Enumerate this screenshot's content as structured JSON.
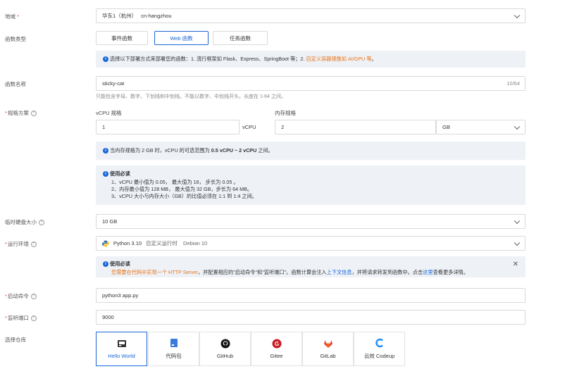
{
  "region": {
    "label": "地域",
    "value_name": "华东1（杭州）",
    "value_code": "cn-hangzhou"
  },
  "function_type": {
    "label": "函数类型",
    "options": [
      "事件函数",
      "Web 函数",
      "任务函数"
    ],
    "selected": "Web 函数"
  },
  "deploy_info": {
    "text": "选择以下部署方式来部署您的函数：1. 流行框架如 Flask、Express、SpringBoot 等；2. ",
    "link": "自定义容器镜像如 AI/GPU 等",
    "suffix": "。"
  },
  "function_name": {
    "label": "函数名称",
    "value": "sticky-cat",
    "counter": "10/64",
    "hint": "只能包含字母、数字、下划线和中划线。不能以数字、中划线开头。长度在 1-64 之间。"
  },
  "spec": {
    "label": "规格方案",
    "vcpu_label": "vCPU 规格",
    "vcpu_value": "1",
    "vcpu_unit": "vCPU",
    "mem_label": "内存规格",
    "mem_value": "2",
    "mem_unit": "GB",
    "range_prefix": "当内存规格为 2 GB 时，vCPU 的可选范围为 ",
    "range_value": "0.5 vCPU ~ 2 vCPU",
    "range_suffix": " 之间。",
    "notice_title": "使用必读",
    "notice_items": [
      "1、vCPU 最小值为 0.05， 最大值为 16， 步长为 0.05 。",
      "2、内存最小值为 128 MB， 最大值为 32 GB，步长为 64 MB。",
      "3、vCPU 大小与内存大小（GB）的比值必须在 1:1 到 1:4 之间。"
    ]
  },
  "disk": {
    "label": "临时硬盘大小",
    "value": "10 GB"
  },
  "runtime": {
    "label": "运行环境",
    "name": "Python 3.10",
    "type": "自定义运行时",
    "os": "Debian 10"
  },
  "runtime_notice": {
    "title": "使用必读",
    "orange_text": "您需要在代码中实现一个 HTTP Server",
    "mid_text": "，并配置相应的\"启动命令\"和\"监听端口\"。函数计算会注入",
    "link1": "上下文信息",
    "mid2": "，并将请求转发到函数中。点击",
    "link2": "这里",
    "end": "查看更多详情。"
  },
  "start_cmd": {
    "label": "启动命令",
    "value": "python3 app.py"
  },
  "listen_port": {
    "label": "监听端口",
    "value": "9000"
  },
  "repo": {
    "label": "选择仓库",
    "options": [
      "Hello World",
      "代码包",
      "GitHub",
      "Gitee",
      "GitLab",
      "云效 Codeup"
    ],
    "selected": "Hello World"
  },
  "colors": {
    "accent": "#1a66d6",
    "required": "#e54545",
    "orange": "#e8731a",
    "info_bg": "#eef2f7"
  }
}
